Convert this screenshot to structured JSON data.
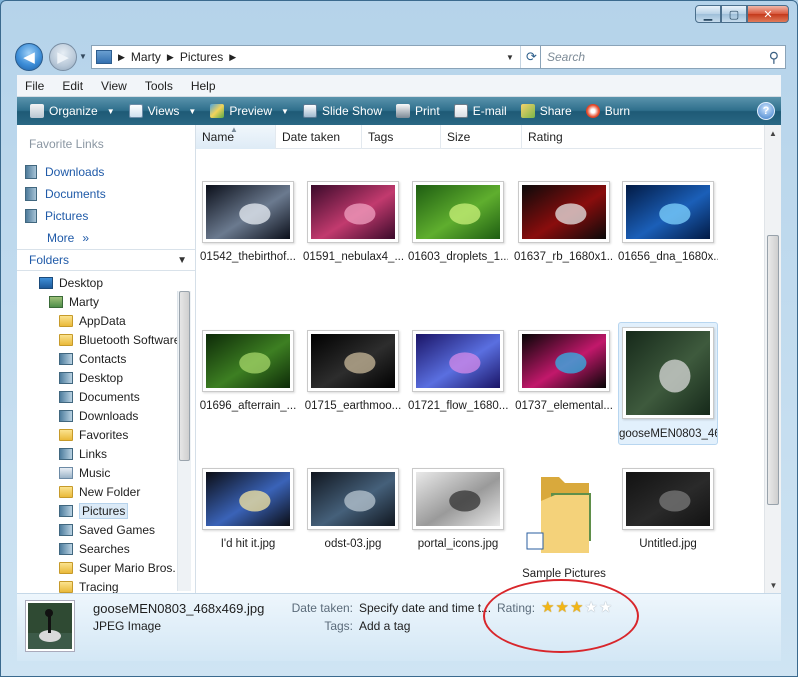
{
  "window": {
    "caption": {
      "minimize": "▁",
      "maximize": "▢",
      "close": "✕"
    }
  },
  "nav": {
    "back_icon": "arrow-left-icon",
    "forward_icon": "arrow-right-icon",
    "breadcrumb": [
      "Marty",
      "Pictures"
    ],
    "search_placeholder": "Search"
  },
  "menu": [
    "File",
    "Edit",
    "View",
    "Tools",
    "Help"
  ],
  "toolbar": {
    "organize": "Organize",
    "views": "Views",
    "preview": "Preview",
    "slideshow": "Slide Show",
    "print": "Print",
    "email": "E-mail",
    "share": "Share",
    "burn": "Burn",
    "help": "?"
  },
  "sidebar": {
    "favorite_links_title": "Favorite Links",
    "favorites": [
      "Downloads",
      "Documents",
      "Pictures"
    ],
    "more": "More",
    "folders_title": "Folders",
    "tree": [
      {
        "label": "Desktop",
        "level": 0,
        "icon": "desktop"
      },
      {
        "label": "Marty",
        "level": 1,
        "icon": "user"
      },
      {
        "label": "AppData",
        "level": 2,
        "icon": "folder"
      },
      {
        "label": "Bluetooth Software",
        "level": 2,
        "icon": "folder"
      },
      {
        "label": "Contacts",
        "level": 2,
        "icon": "special"
      },
      {
        "label": "Desktop",
        "level": 2,
        "icon": "special"
      },
      {
        "label": "Documents",
        "level": 2,
        "icon": "special"
      },
      {
        "label": "Downloads",
        "level": 2,
        "icon": "special"
      },
      {
        "label": "Favorites",
        "level": 2,
        "icon": "folder"
      },
      {
        "label": "Links",
        "level": 2,
        "icon": "special"
      },
      {
        "label": "Music",
        "level": 2,
        "icon": "music"
      },
      {
        "label": "New Folder",
        "level": 2,
        "icon": "folder"
      },
      {
        "label": "Pictures",
        "level": 2,
        "icon": "special",
        "selected": true
      },
      {
        "label": "Saved Games",
        "level": 2,
        "icon": "special"
      },
      {
        "label": "Searches",
        "level": 2,
        "icon": "special"
      },
      {
        "label": "Super Mario Bros.",
        "level": 2,
        "icon": "folder"
      },
      {
        "label": "Tracing",
        "level": 2,
        "icon": "folder"
      }
    ]
  },
  "columns": [
    "Name",
    "Date taken",
    "Tags",
    "Size",
    "Rating"
  ],
  "files": [
    {
      "name": "01542_thebirthof...",
      "palette": [
        "#0b0f1a",
        "#6b7a8f",
        "#e8eef4"
      ]
    },
    {
      "name": "01591_nebulax4_...",
      "palette": [
        "#3a0a2a",
        "#c23a6e",
        "#f0a0c0"
      ]
    },
    {
      "name": "01603_droplets_1...",
      "palette": [
        "#1e5d12",
        "#5fae2e",
        "#c9f07a"
      ]
    },
    {
      "name": "01637_rb_1680x1...",
      "palette": [
        "#0a0a0a",
        "#8a0d0d",
        "#e6e6e6"
      ]
    },
    {
      "name": "01656_dna_1680x...",
      "palette": [
        "#021a44",
        "#1b5fb8",
        "#7fd3ff"
      ]
    },
    {
      "name": "01696_afterrain_...",
      "palette": [
        "#0d2a08",
        "#3d7f22",
        "#a6d66a"
      ]
    },
    {
      "name": "01715_earthmoo...",
      "palette": [
        "#000000",
        "#2d2d2d",
        "#c8b89a"
      ]
    },
    {
      "name": "01721_flow_1680...",
      "palette": [
        "#1a1466",
        "#5a6fe0",
        "#d48ae8"
      ]
    },
    {
      "name": "01737_elemental...",
      "palette": [
        "#050505",
        "#c2186b",
        "#2fb4e8"
      ]
    },
    {
      "name": "gooseMEN0803_468x469.jpg",
      "palette": [
        "#16291a",
        "#3e5a3d",
        "#d9d9d9"
      ],
      "selected": true
    },
    {
      "name": "I'd hit it.jpg",
      "palette": [
        "#0b0d14",
        "#3a63b8",
        "#f7e7a0"
      ]
    },
    {
      "name": "odst-03.jpg",
      "palette": [
        "#10161f",
        "#45607a",
        "#b8c6d0"
      ]
    },
    {
      "name": "portal_icons.jpg",
      "palette": [
        "#e9e9e9",
        "#9a9a9a",
        "#333333"
      ]
    },
    {
      "name": "Sample Pictures",
      "palette": [
        "#f4d27a",
        "#d9a93c",
        "#5f8f4a"
      ],
      "folder": true
    },
    {
      "name": "Untitled.jpg",
      "palette": [
        "#121212",
        "#2a2a2a",
        "#7a7a7a"
      ]
    }
  ],
  "details": {
    "name": "gooseMEN0803_468x469.jpg",
    "type": "JPEG Image",
    "date_label": "Date taken:",
    "date_value": "Specify date and time t...",
    "tags_label": "Tags:",
    "tags_value": "Add a tag",
    "rating_label": "Rating:",
    "rating_value": 3,
    "rating_max": 5
  }
}
